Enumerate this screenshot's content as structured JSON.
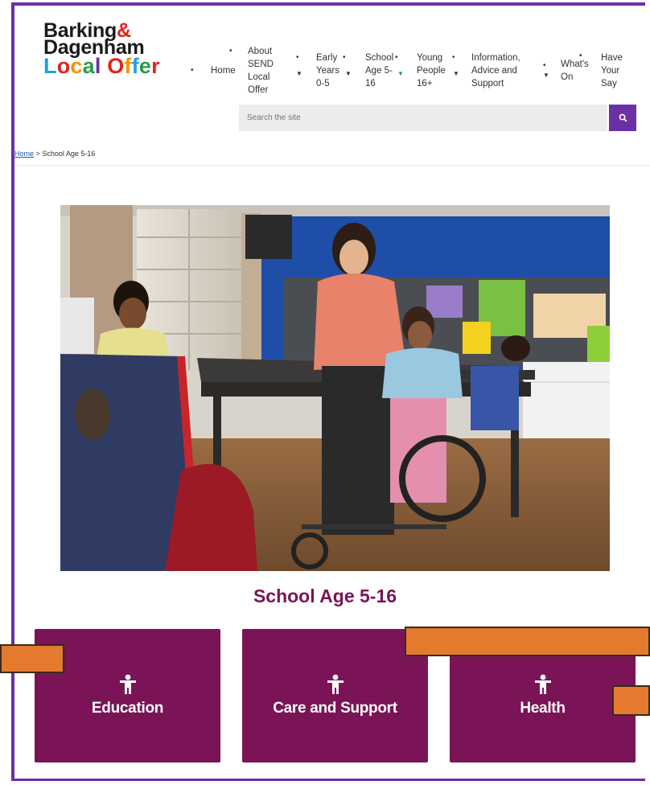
{
  "logo": {
    "line1": "Barking",
    "amp": "&",
    "line2": "Dagenham",
    "line3": [
      "L",
      "o",
      "c",
      "a",
      "l",
      " ",
      "O",
      "f",
      "f",
      "e",
      "r"
    ],
    "line3_colors": [
      "#1fa0dc",
      "#e2231a",
      "#f39200",
      "#2a9d4a",
      "#6b2fa6",
      "#ffffff",
      "#e2231a",
      "#f39200",
      "#1fa0dc",
      "#2a9d4a",
      "#e2231a"
    ]
  },
  "nav": {
    "home": "Home",
    "about": [
      "About",
      "SEND",
      "Local",
      "Offer"
    ],
    "early": [
      "Early",
      "Years",
      "0-5"
    ],
    "school": [
      "School",
      "Age 5-",
      "16"
    ],
    "young": [
      "Young",
      "People",
      "16+"
    ],
    "info": [
      "Information,",
      "Advice and",
      "Support"
    ],
    "whats": [
      "What's",
      "On"
    ],
    "have": [
      "Have",
      "Your",
      "Say"
    ]
  },
  "search": {
    "placeholder": "Search the site"
  },
  "breadcrumb": {
    "home": "Home",
    "separator": ">",
    "current": "School Age 5-16"
  },
  "page_title": "School Age 5-16",
  "tiles": [
    {
      "label": "Education",
      "icon": "child-icon"
    },
    {
      "label": "Care and Support",
      "icon": "child-icon"
    },
    {
      "label": "Health",
      "icon": "child-icon"
    }
  ],
  "colors": {
    "brand_purple": "#6b2fa6",
    "tile_plum": "#7a1456",
    "overlay_orange": "#e47a2e"
  }
}
